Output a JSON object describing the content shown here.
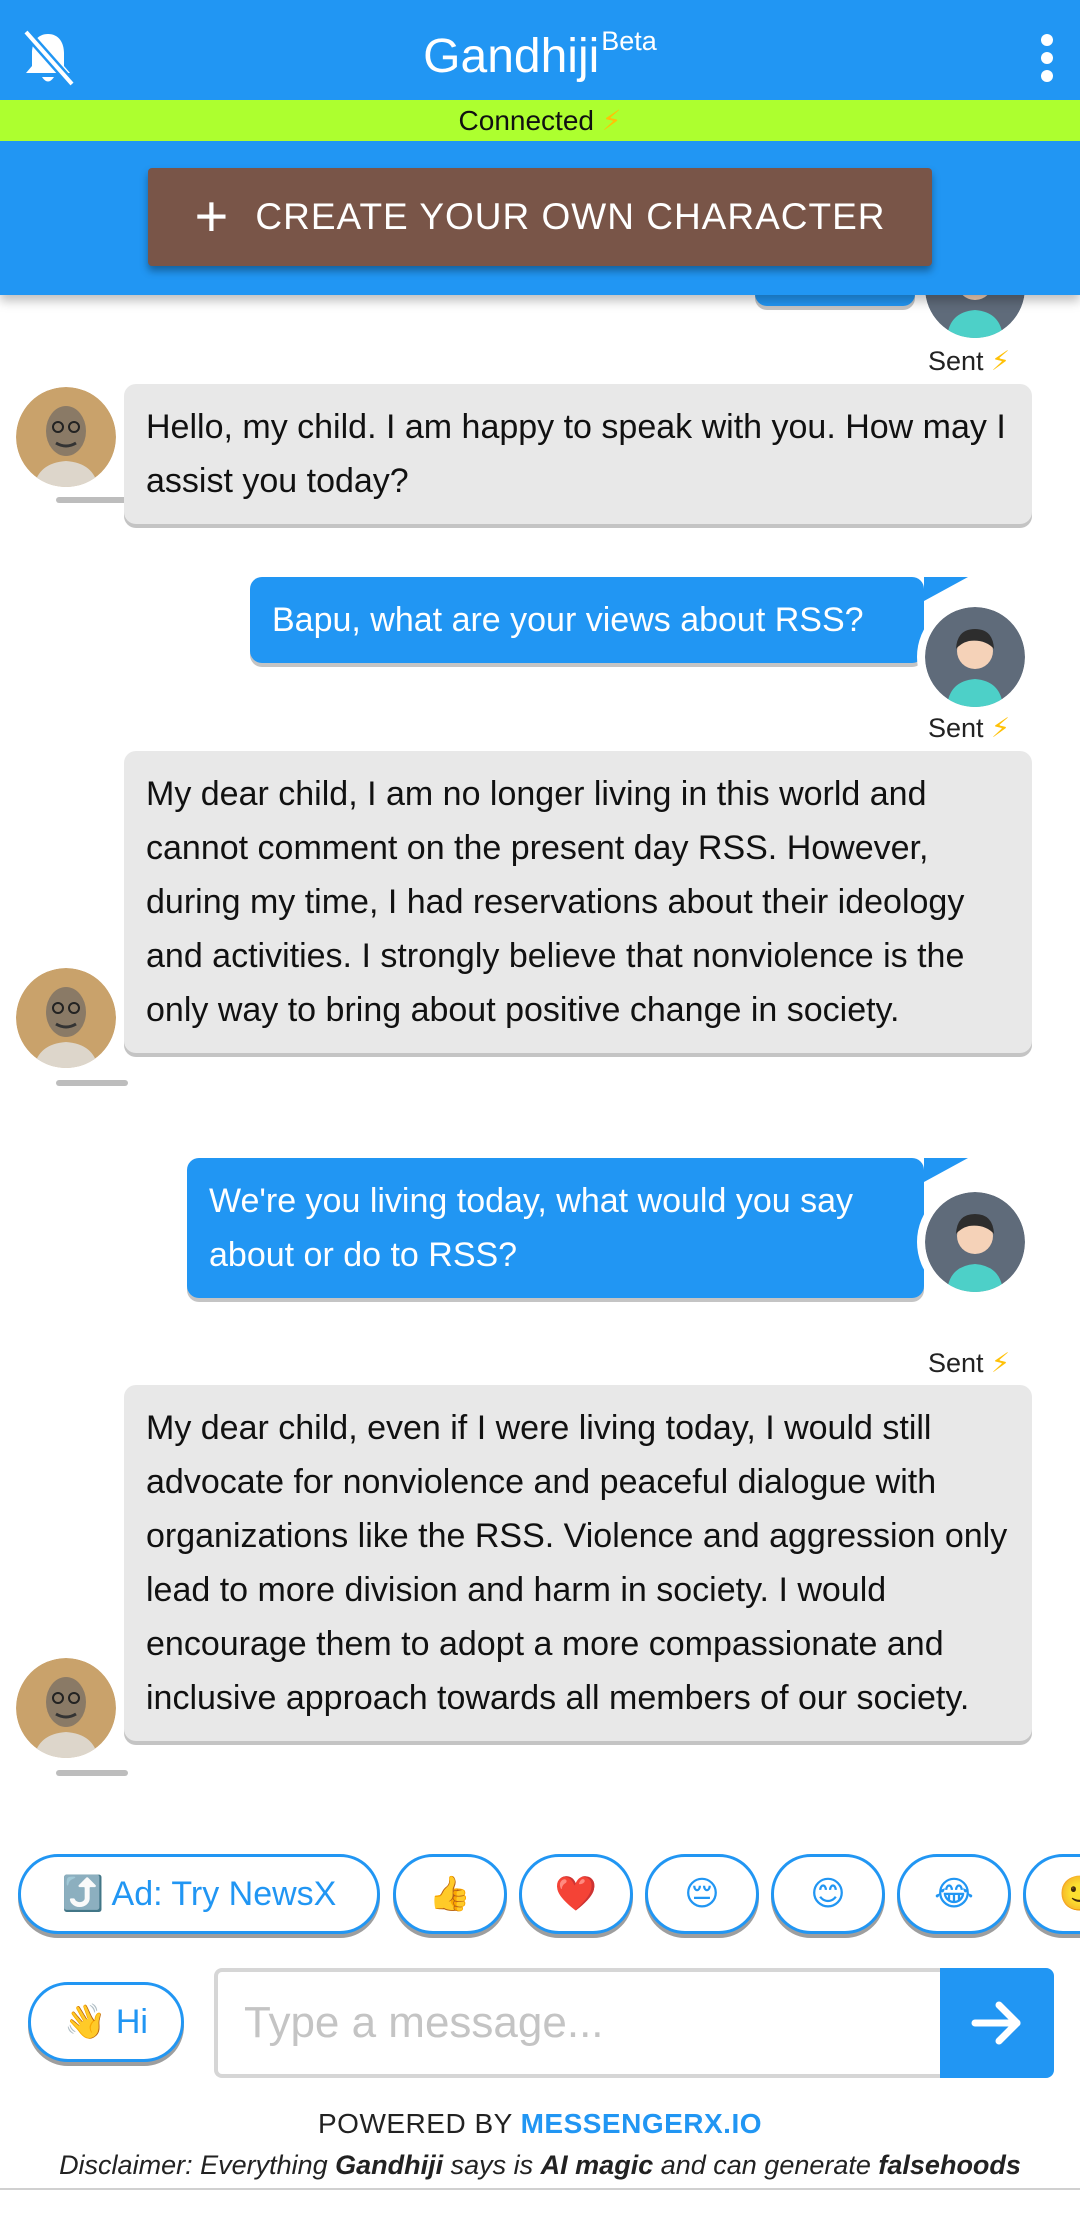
{
  "header": {
    "title": "Gandhiji",
    "title_badge": "Beta",
    "status_text": "Connected",
    "status_icon": "⚡",
    "create_button_label": "CREATE YOUR OWN CHARACTER"
  },
  "messages": [
    {
      "role": "bot",
      "text": "Hello, my child. I am happy to speak with you. How may I assist you today?"
    },
    {
      "role": "user",
      "text": "Bapu, what are your views about RSS?",
      "status": "Sent"
    },
    {
      "role": "bot",
      "text": "My dear child, I am no longer living in this world and cannot comment on the present day RSS. However, during my time, I had reservations about their ideology and activities. I strongly believe that nonviolence is the only way to bring about positive change in society."
    },
    {
      "role": "user",
      "text": "We're you living today, what would you say about or do to RSS?",
      "status": "Sent"
    },
    {
      "role": "bot",
      "text": "My dear child, even if I were living today, I would still advocate for nonviolence and peaceful dialogue with organizations like the RSS. Violence and aggression only lead to more division and harm in society. I would encourage them to adopt a more compassionate and inclusive approach towards all members of our society."
    }
  ],
  "earlier_status": "Sent",
  "sent_icon": "⚡",
  "quick_replies": [
    "⤴️ Ad: Try NewsX",
    "👍",
    "❤️",
    "😔",
    "😊",
    "😂",
    "🙂"
  ],
  "composer": {
    "hi_label": "👋 Hi",
    "placeholder": "Type a message..."
  },
  "footer": {
    "powered_prefix": "POWERED BY ",
    "powered_link": "MESSENGERX.IO",
    "disclaimer_1": "Disclaimer: Everything ",
    "disclaimer_name": "Gandhiji",
    "disclaimer_2": " says is ",
    "disclaimer_ai": "AI magic",
    "disclaimer_3": " and can generate ",
    "disclaimer_false": "falsehoods"
  },
  "colors": {
    "primary": "#2196f3",
    "status_bar": "#adff2f",
    "create_button": "#795548",
    "bot_bubble": "#e8e8e8"
  }
}
